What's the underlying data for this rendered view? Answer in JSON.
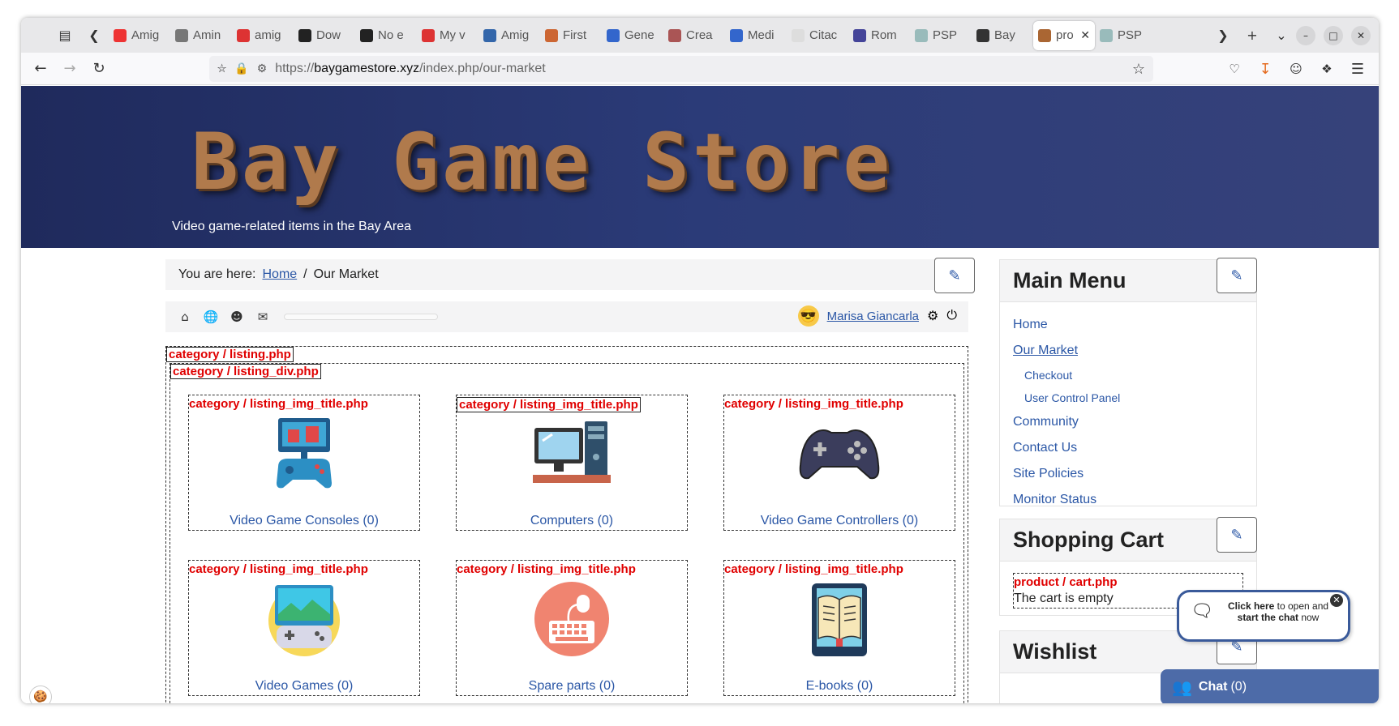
{
  "browser": {
    "tabs": [
      {
        "label": "Amig",
        "color": "#e33"
      },
      {
        "label": "Amin",
        "color": "#777"
      },
      {
        "label": "amig",
        "color": "#d33"
      },
      {
        "label": "Dow",
        "color": "#222"
      },
      {
        "label": "No e",
        "color": "#222"
      },
      {
        "label": "My v",
        "color": "#d33"
      },
      {
        "label": "Amig",
        "color": "#36a"
      },
      {
        "label": "First",
        "color": "#c63"
      },
      {
        "label": "Gene",
        "color": "#36c"
      },
      {
        "label": "Crea",
        "color": "#a55"
      },
      {
        "label": "Medi",
        "color": "#36c"
      },
      {
        "label": "Citac",
        "color": "#ddd"
      },
      {
        "label": "Rom",
        "color": "#449"
      },
      {
        "label": "PSP",
        "color": "#9bb"
      },
      {
        "label": "Bay",
        "color": "#333"
      },
      {
        "label": "pro",
        "color": "#a63",
        "active": true
      },
      {
        "label": "PSP",
        "color": "#9bb"
      }
    ],
    "url_prefix": "https://",
    "url_host": "baygamestore.xyz",
    "url_path": "/index.php/our-market"
  },
  "header": {
    "logo_text": "Bay Game Store",
    "tagline": "Video game-related items in the Bay Area"
  },
  "breadcrumb": {
    "prefix": "You are here:",
    "home": "Home",
    "separator": "/",
    "current": "Our Market"
  },
  "toolbar": {
    "user_name": "Marisa Giancarla"
  },
  "listing": {
    "debug_listing": "category / listing.php",
    "debug_listing_div": "category / listing_div.php",
    "card_debug": "category / listing_img_title.php",
    "categories": [
      {
        "title": "Video Game Consoles (0)",
        "icon": "console-icon"
      },
      {
        "title": "Computers (0)",
        "icon": "computer-icon"
      },
      {
        "title": "Video Game Controllers (0)",
        "icon": "gamepad-icon"
      },
      {
        "title": "Video Games (0)",
        "icon": "handheld-game-icon"
      },
      {
        "title": "Spare parts (0)",
        "icon": "keyboard-mouse-icon"
      },
      {
        "title": "E-books (0)",
        "icon": "ebook-icon"
      }
    ]
  },
  "sidebar": {
    "main_menu_title": "Main Menu",
    "menu_items": {
      "home": "Home",
      "our_market": "Our Market",
      "checkout": "Checkout",
      "user_cp": "User Control Panel",
      "community": "Community",
      "contact": "Contact Us",
      "policies": "Site Policies",
      "monitor": "Monitor Status"
    },
    "cart_title": "Shopping Cart",
    "cart_debug": "product / cart.php",
    "cart_empty": "The cart is empty",
    "wishlist_title": "Wishlist"
  },
  "chat": {
    "bubble_bold1": "Click here",
    "bubble_text1": " to open and",
    "bubble_bold2": "start the chat",
    "bubble_text2": " now",
    "bar_label": "Chat",
    "bar_count": "(0)"
  },
  "colors": {
    "header_bg": "#2b3b78",
    "link": "#2b57a6",
    "debug_red": "#e00000",
    "chat_blue": "#4d6ba8"
  }
}
